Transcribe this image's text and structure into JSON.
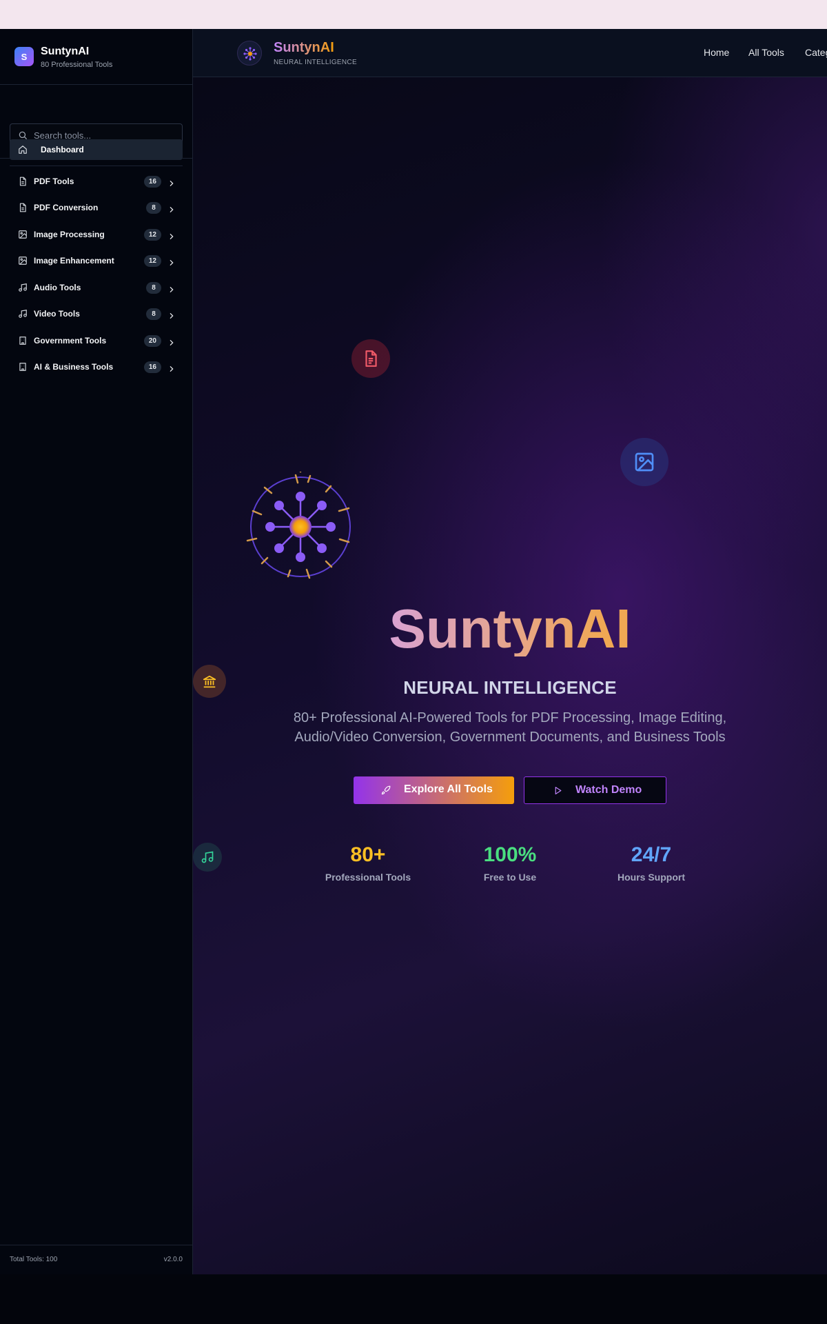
{
  "sidebar": {
    "brand_name": "SuntynAI",
    "brand_sub": "80 Professional Tools",
    "brand_logo_letter": "S",
    "search_placeholder": "Search tools...",
    "dashboard_label": "Dashboard",
    "items": [
      {
        "label": "PDF Tools",
        "count": "16",
        "icon": "file-icon"
      },
      {
        "label": "PDF Conversion",
        "count": "8",
        "icon": "file-icon"
      },
      {
        "label": "Image Processing",
        "count": "12",
        "icon": "image-icon"
      },
      {
        "label": "Image Enhancement",
        "count": "12",
        "icon": "image-icon"
      },
      {
        "label": "Audio Tools",
        "count": "8",
        "icon": "music-icon"
      },
      {
        "label": "Video Tools",
        "count": "8",
        "icon": "music-icon"
      },
      {
        "label": "Government Tools",
        "count": "20",
        "icon": "building-icon"
      },
      {
        "label": "AI & Business Tools",
        "count": "16",
        "icon": "building-icon"
      }
    ],
    "footer_total": "Total Tools: 100",
    "footer_version": "v2.0.0"
  },
  "topbar": {
    "name": "SuntynAI",
    "sub": "NEURAL INTELLIGENCE",
    "nav": [
      "Home",
      "All Tools",
      "Categ"
    ]
  },
  "hero": {
    "title": "SuntynAI",
    "subtitle": "NEURAL INTELLIGENCE",
    "description": "80+ Professional AI-Powered Tools for PDF Processing, Image Editing, Audio/Video Conversion, Government Documents, and Business Tools",
    "primary_button": "Explore All Tools",
    "secondary_button": "Watch Demo"
  },
  "stats": [
    {
      "value": "80+",
      "label": "Professional Tools",
      "color": "#fbbf24"
    },
    {
      "value": "100%",
      "label": "Free to Use",
      "color": "#4ade80"
    },
    {
      "value": "24/7",
      "label": "Hours Support",
      "color": "#60a5fa"
    }
  ],
  "colors": {
    "accent_purple": "#9333ea",
    "accent_orange": "#f59e0b"
  }
}
